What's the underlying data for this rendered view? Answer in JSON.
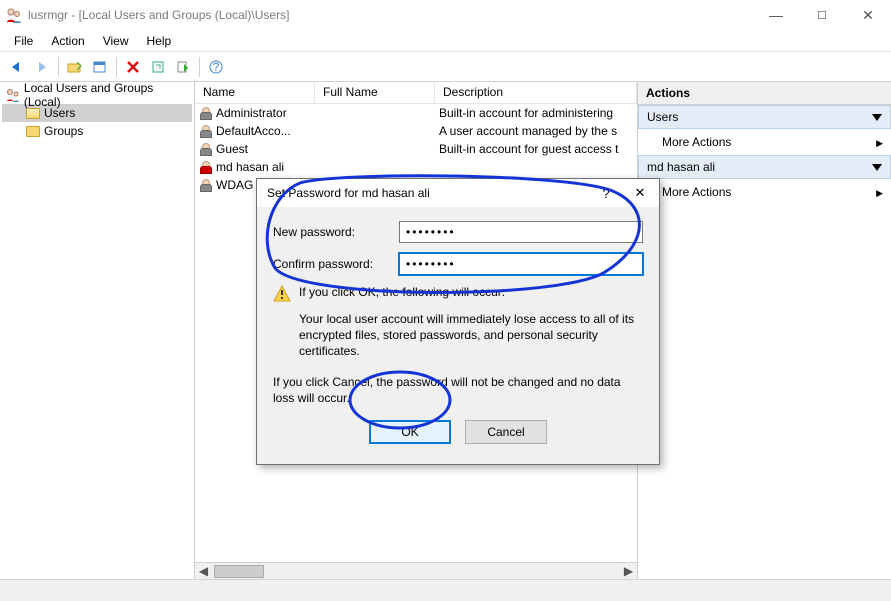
{
  "title": "lusrmgr - [Local Users and Groups (Local)\\Users]",
  "menubar": [
    "File",
    "Action",
    "View",
    "Help"
  ],
  "tree": {
    "root": "Local Users and Groups (Local)",
    "items": [
      "Users",
      "Groups"
    ]
  },
  "columns": [
    "Name",
    "Full Name",
    "Description"
  ],
  "users": [
    {
      "name": "Administrator",
      "full": "",
      "desc": "Built-in account for administering",
      "disabled": true
    },
    {
      "name": "DefaultAcco...",
      "full": "",
      "desc": "A user account managed by the s",
      "disabled": true
    },
    {
      "name": "Guest",
      "full": "",
      "desc": "Built-in account for guest access t",
      "disabled": true
    },
    {
      "name": "md hasan ali",
      "full": "",
      "desc": "",
      "disabled": false
    },
    {
      "name": "WDAG",
      "full": "",
      "desc": "",
      "disabled": true
    }
  ],
  "actions": {
    "header": "Actions",
    "sections": [
      {
        "title": "Users",
        "items": [
          "More Actions"
        ]
      },
      {
        "title": "md hasan ali",
        "items": [
          "More Actions"
        ]
      }
    ]
  },
  "dialog": {
    "title": "Set Password for md hasan ali",
    "new_label": "New password:",
    "confirm_label": "Confirm password:",
    "new_value": "••••••••",
    "confirm_value": "••••••••",
    "warn_line": "If you click OK, the following will occur:",
    "warn_body": "Your local user account will immediately lose access to all of its encrypted files, stored passwords, and personal security certificates.",
    "cancel_body": "If you click Cancel, the password will not be changed and no data loss will occur.",
    "ok": "OK",
    "cancel": "Cancel"
  }
}
